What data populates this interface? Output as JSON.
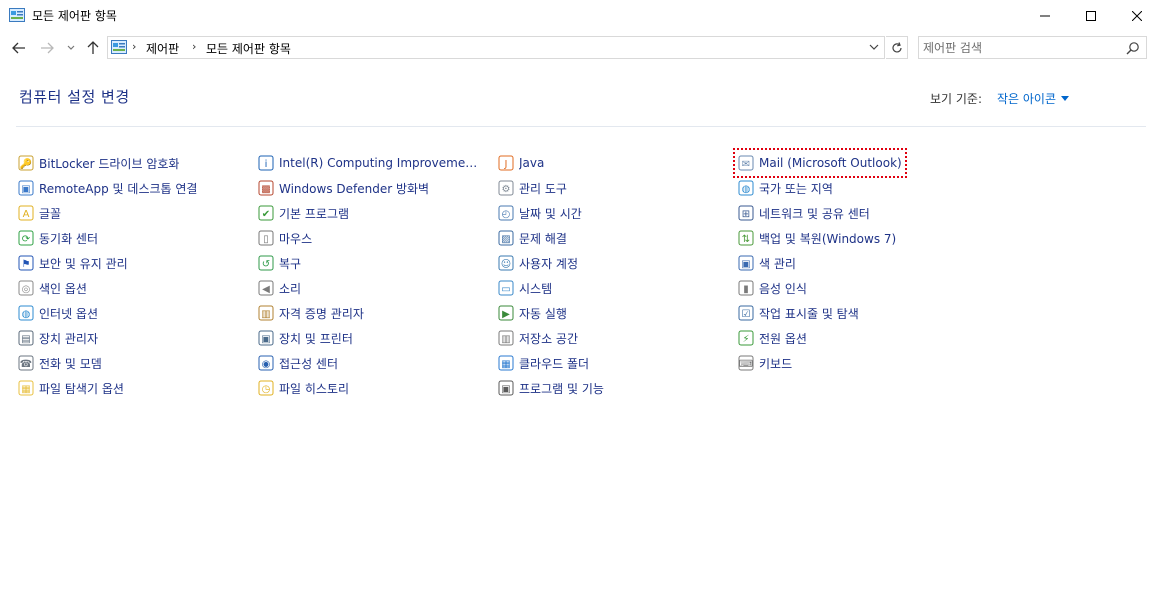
{
  "window": {
    "title": "모든 제어판 항목"
  },
  "nav": {
    "breadcrumb": [
      "제어판",
      "모든 제어판 항목"
    ],
    "search_placeholder": "제어판 검색"
  },
  "header": {
    "title": "컴퓨터 설정 변경",
    "view_by_label": "보기 기준:",
    "view_by_value": "작은 아이콘"
  },
  "columns": [
    [
      {
        "label": "BitLocker 드라이브 암호화",
        "icon": "bitlocker-icon",
        "color": "#c8a030"
      },
      {
        "label": "RemoteApp 및 데스크톱 연결",
        "icon": "remoteapp-icon",
        "color": "#3a78c8"
      },
      {
        "label": "글꼴",
        "icon": "font-icon",
        "color": "#e0b020"
      },
      {
        "label": "동기화 센터",
        "icon": "sync-center-icon",
        "color": "#2ea043"
      },
      {
        "label": "보안 및 유지 관리",
        "icon": "flag-icon",
        "color": "#2355b5"
      },
      {
        "label": "색인 옵션",
        "icon": "indexing-icon",
        "color": "#8a8a8a"
      },
      {
        "label": "인터넷 옵션",
        "icon": "internet-options-icon",
        "color": "#2e8bd0"
      },
      {
        "label": "장치 관리자",
        "icon": "device-manager-icon",
        "color": "#5a6a7a"
      },
      {
        "label": "전화 및 모뎀",
        "icon": "phone-modem-icon",
        "color": "#6b7580"
      },
      {
        "label": "파일 탐색기 옵션",
        "icon": "folder-options-icon",
        "color": "#e8c040"
      }
    ],
    [
      {
        "label": "Intel(R) Computing Improvement Pr...",
        "icon": "intel-icon",
        "color": "#1b61b3"
      },
      {
        "label": "Windows Defender 방화벽",
        "icon": "firewall-icon",
        "color": "#b4452d"
      },
      {
        "label": "기본 프로그램",
        "icon": "default-programs-icon",
        "color": "#3a9a3a"
      },
      {
        "label": "마우스",
        "icon": "mouse-icon",
        "color": "#777777"
      },
      {
        "label": "복구",
        "icon": "recovery-icon",
        "color": "#2f9a4a"
      },
      {
        "label": "소리",
        "icon": "speaker-icon",
        "color": "#7a7a7a"
      },
      {
        "label": "자격 증명 관리자",
        "icon": "credential-manager-icon",
        "color": "#b08030"
      },
      {
        "label": "장치 및 프린터",
        "icon": "devices-printers-icon",
        "color": "#4a6a8a"
      },
      {
        "label": "접근성 센터",
        "icon": "ease-of-access-icon",
        "color": "#2860b0"
      },
      {
        "label": "파일 히스토리",
        "icon": "file-history-icon",
        "color": "#e0b020"
      }
    ],
    [
      {
        "label": "Java",
        "icon": "java-icon",
        "color": "#e06b20"
      },
      {
        "label": "관리 도구",
        "icon": "admin-tools-icon",
        "color": "#808a95"
      },
      {
        "label": "날짜 및 시간",
        "icon": "date-time-icon",
        "color": "#4a7ab0"
      },
      {
        "label": "문제 해결",
        "icon": "troubleshooting-icon",
        "color": "#3a6aa0"
      },
      {
        "label": "사용자 계정",
        "icon": "user-accounts-icon",
        "color": "#3a7ab0"
      },
      {
        "label": "시스템",
        "icon": "system-icon",
        "color": "#3a88c8"
      },
      {
        "label": "자동 실행",
        "icon": "autoplay-icon",
        "color": "#3a8a3a"
      },
      {
        "label": "저장소 공간",
        "icon": "storage-spaces-icon",
        "color": "#7a7a7a"
      },
      {
        "label": "클라우드 폴더",
        "icon": "work-folders-icon",
        "color": "#2a7ad0"
      },
      {
        "label": "프로그램 및 기능",
        "icon": "programs-features-icon",
        "color": "#5a5a5a"
      }
    ],
    [
      {
        "label": "Mail (Microsoft Outlook)",
        "icon": "mail-icon",
        "color": "#6a8ab0",
        "focused": true
      },
      {
        "label": "국가 또는 지역",
        "icon": "region-icon",
        "color": "#2e8bd0"
      },
      {
        "label": "네트워크 및 공유 센터",
        "icon": "network-icon",
        "color": "#3a5a90"
      },
      {
        "label": "백업 및 복원(Windows 7)",
        "icon": "backup-icon",
        "color": "#4a9a3a"
      },
      {
        "label": "색 관리",
        "icon": "color-management-icon",
        "color": "#3a6ab0"
      },
      {
        "label": "음성 인식",
        "icon": "microphone-icon",
        "color": "#7a7a7a"
      },
      {
        "label": "작업 표시줄 및 탐색",
        "icon": "taskbar-icon",
        "color": "#3a6aa0"
      },
      {
        "label": "전원 옵션",
        "icon": "power-options-icon",
        "color": "#3a9a3a"
      },
      {
        "label": "키보드",
        "icon": "keyboard-icon",
        "color": "#7a7a7a"
      }
    ]
  ]
}
